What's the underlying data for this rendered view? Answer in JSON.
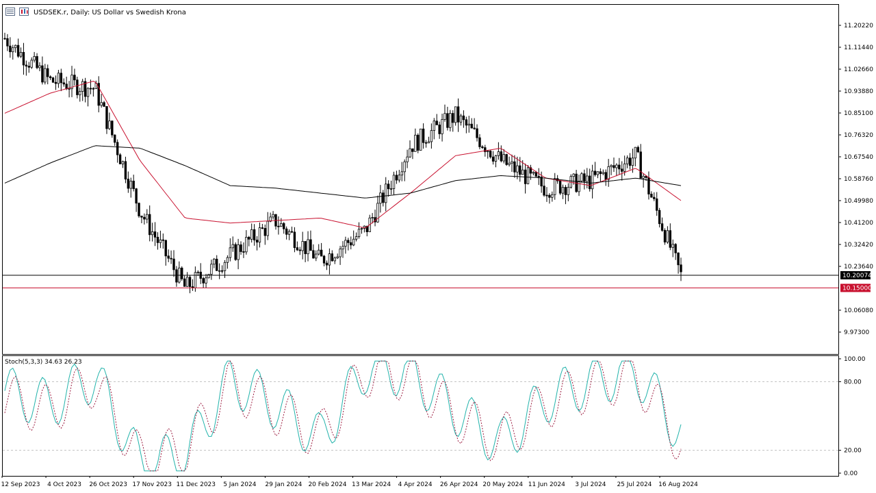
{
  "header": {
    "symbol": "USDSEK.r",
    "timeframe": "Daily",
    "description": "US Dollar vs Swedish Krona",
    "title": "USDSEK.r, Daily:  US Dollar vs Swedish Krona"
  },
  "icons": [
    "menu-icon",
    "chart-type-icon"
  ],
  "colors": {
    "background": "#ffffff",
    "candle": "#000000",
    "ma_fast": "#c8102e",
    "ma_slow": "#000000",
    "stoch_main": "#20b2aa",
    "stoch_signal": "#9b1b3f",
    "current_price_badge": "#000000",
    "line_level_badge": "#c8102e"
  },
  "price_scale": {
    "ticks": [
      "11.20220",
      "11.11440",
      "11.02660",
      "10.93880",
      "10.85100",
      "10.76320",
      "10.67540",
      "10.58760",
      "10.49980",
      "10.41200",
      "10.32420",
      "10.23640",
      "10.06080",
      "9.97300"
    ],
    "current_price_label": "10.20074",
    "horizontal_line_label": "10.15000"
  },
  "time_axis": {
    "labels": [
      "12 Sep 2023",
      "4 Oct 2023",
      "26 Oct 2023",
      "17 Nov 2023",
      "11 Dec 2023",
      "5 Jan 2024",
      "29 Jan 2024",
      "20 Feb 2024",
      "13 Mar 2024",
      "4 Apr 2024",
      "26 Apr 2024",
      "20 May 2024",
      "11 Jun 2024",
      "3 Jul 2024",
      "25 Jul 2024",
      "16 Aug 2024"
    ]
  },
  "indicator": {
    "name": "Stoch(5,3,3)",
    "main_value": "34.63",
    "signal_value": "26.23",
    "label": "Stoch(5,3,3) 34.63 26.23",
    "scale_ticks": [
      "100.00",
      "80.00",
      "20.00",
      "0.00"
    ]
  },
  "chart_data": [
    {
      "type": "candlestick",
      "title": "USDSEK.r, Daily:  US Dollar vs Swedish Krona",
      "x_categories": [
        "12 Sep 2023",
        "4 Oct 2023",
        "26 Oct 2023",
        "17 Nov 2023",
        "11 Dec 2023",
        "5 Jan 2024",
        "29 Jan 2024",
        "20 Feb 2024",
        "13 Mar 2024",
        "4 Apr 2024",
        "26 Apr 2024",
        "20 May 2024",
        "11 Jun 2024",
        "3 Jul 2024",
        "25 Jul 2024",
        "16 Aug 2024"
      ],
      "series": [
        {
          "name": "Close (approx. at labeled dates)",
          "values": [
            11.15,
            10.98,
            10.95,
            10.46,
            10.15,
            10.28,
            10.42,
            10.26,
            10.38,
            10.72,
            10.84,
            10.66,
            10.55,
            10.58,
            10.68,
            10.2
          ]
        },
        {
          "name": "Fast MA (approx.)",
          "values": [
            10.85,
            10.93,
            10.98,
            10.66,
            10.43,
            10.41,
            10.42,
            10.43,
            10.39,
            10.53,
            10.68,
            10.71,
            10.59,
            10.56,
            10.63,
            10.5
          ]
        },
        {
          "name": "Slow MA (approx.)",
          "values": [
            10.57,
            10.65,
            10.72,
            10.71,
            10.64,
            10.56,
            10.55,
            10.53,
            10.51,
            10.53,
            10.58,
            10.6,
            10.59,
            10.57,
            10.59,
            10.56
          ]
        }
      ],
      "y_range": [
        9.93,
        11.25
      ],
      "horizontal_levels": [
        10.20074,
        10.15
      ],
      "grid": false
    },
    {
      "type": "line",
      "title": "Stoch(5,3,3) 34.63 26.23",
      "x_categories": [
        "12 Sep 2023",
        "4 Oct 2023",
        "26 Oct 2023",
        "17 Nov 2023",
        "11 Dec 2023",
        "5 Jan 2024",
        "29 Jan 2024",
        "20 Feb 2024",
        "13 Mar 2024",
        "4 Apr 2024",
        "26 Apr 2024",
        "20 May 2024",
        "11 Jun 2024",
        "3 Jul 2024",
        "25 Jul 2024",
        "16 Aug 2024"
      ],
      "series": [
        {
          "name": "Main (approx.)",
          "values": [
            72,
            60,
            85,
            8,
            15,
            82,
            60,
            30,
            92,
            88,
            55,
            25,
            65,
            80,
            90,
            34.63
          ]
        },
        {
          "name": "Signal (approx.)",
          "values": [
            65,
            55,
            80,
            12,
            20,
            78,
            55,
            32,
            88,
            85,
            50,
            28,
            60,
            76,
            86,
            26.23
          ]
        }
      ],
      "y_range": [
        0,
        100
      ],
      "levels": [
        20,
        80
      ]
    }
  ]
}
